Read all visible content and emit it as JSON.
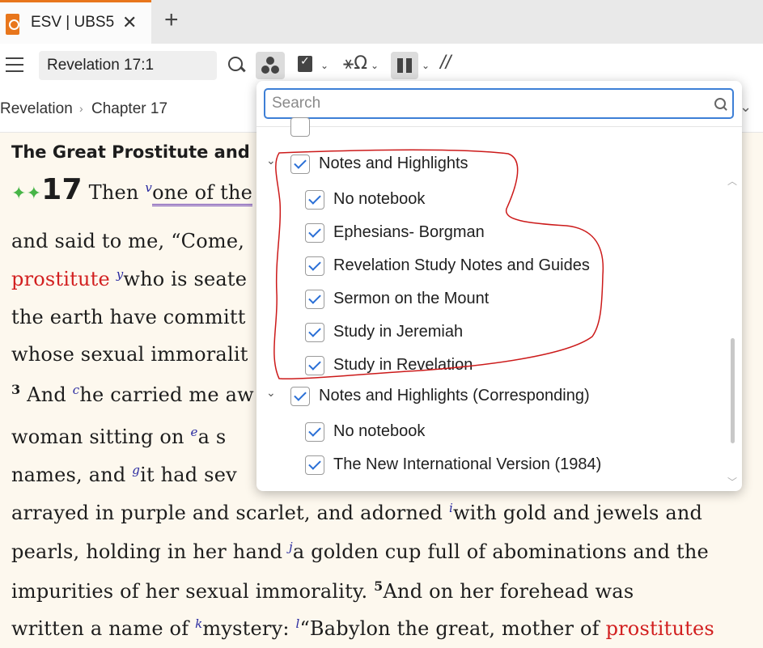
{
  "tab": {
    "title": "ESV | UBS5"
  },
  "toolbar": {
    "reference": "Revelation 17:1"
  },
  "breadcrumb": {
    "book": "Revelation",
    "chapter": "Chapter 17"
  },
  "passage": {
    "heading": "The Great Prostitute and",
    "chapter_number": "17",
    "lines": {
      "l1a": "Then ",
      "l1fn": "v",
      "l1b": "one of the",
      "l2": "and said to me, “Come,",
      "l3red": "prostitute ",
      "l3fn": "y",
      "l3b": "who is seate",
      "l4": "the earth have committ",
      "l5": "whose sexual immoralit",
      "l6num": "3",
      "l6a": " And ",
      "l6fn": "c",
      "l6b": "he carried me aw",
      "l7a": "woman sitting on ",
      "l7fn": "e",
      "l7b": "a s",
      "l8a": "names, and ",
      "l8fn": "g",
      "l8b": "it had sev",
      "l9a": "arrayed in purple and scarlet, and adorned ",
      "l9fn": "i",
      "l9b": "with gold and jewels and",
      "l10a": "pearls, holding in her hand ",
      "l10fn": "j",
      "l10b": "a golden cup full of abominations and the",
      "l11a": "impurities of her sexual immorality. ",
      "l11num": "5",
      "l11b": "And on her forehead was",
      "l12a": "written a name of ",
      "l12fn": "k",
      "l12b": "mystery: ",
      "l12fn2": "l",
      "l12c": "“Babylon the great, mother of ",
      "l12red": "prostitutes"
    }
  },
  "dropdown": {
    "search_placeholder": "Search",
    "groups": [
      {
        "label": "Notes and Highlights",
        "checked": true,
        "items": [
          "No notebook",
          "Ephesians- Borgman",
          "Revelation Study Notes and Guides",
          "Sermon on the Mount",
          "Study in Jeremiah",
          "Study in Revelation"
        ]
      },
      {
        "label": "Notes and Highlights (Corresponding)",
        "checked": true,
        "items": [
          "No notebook",
          "The New International Version (1984)"
        ]
      }
    ]
  },
  "colors": {
    "accent": "#e8761c",
    "checkbox": "#2a6fd6",
    "search_border": "#3d7fd6",
    "words_of_christ": "#d21f1f",
    "annotation": "#cc1a1a"
  }
}
